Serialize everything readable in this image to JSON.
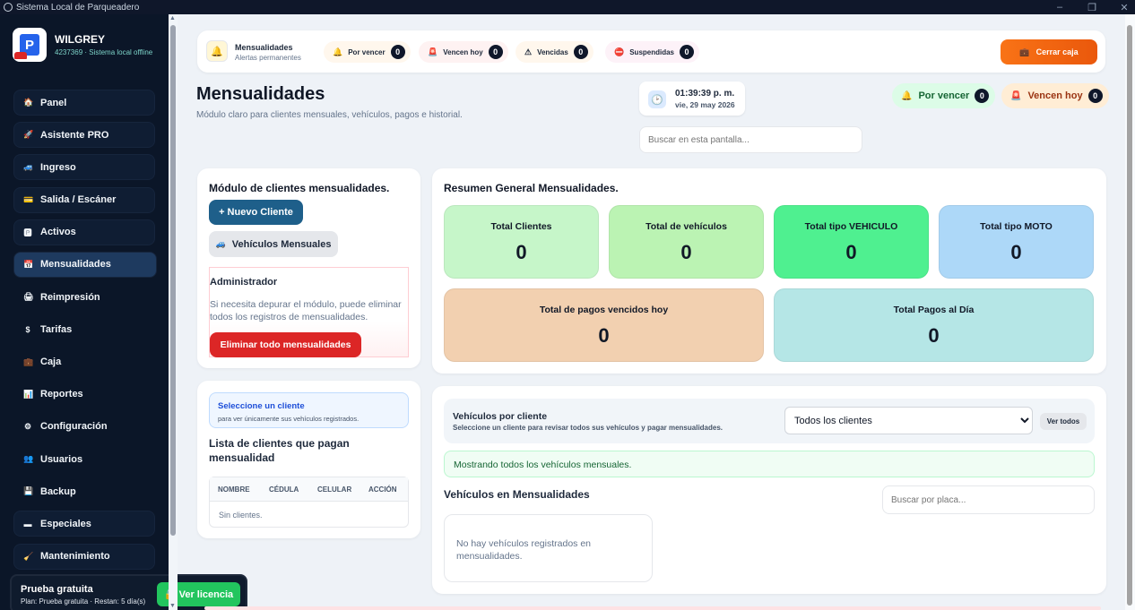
{
  "window": {
    "title": "Sistema Local de Parqueadero",
    "controls": [
      "–",
      "❐",
      "✕"
    ]
  },
  "brand": {
    "name": "WILGREY",
    "subtitle": "4237369 · Sistema local offline"
  },
  "sidebar": {
    "items": [
      {
        "label": "Panel",
        "icon": "home-icon",
        "glyph": "🏠"
      },
      {
        "label": "Asistente PRO",
        "icon": "rocket-icon",
        "glyph": "🚀"
      },
      {
        "label": "Ingreso",
        "icon": "car-icon",
        "glyph": "🚙"
      },
      {
        "label": "Salida / Escáner",
        "icon": "scanner-icon",
        "glyph": "💳"
      },
      {
        "label": "Activos",
        "icon": "parking-icon",
        "glyph": "🅿"
      },
      {
        "label": "Mensualidades",
        "icon": "calendar-icon",
        "glyph": "📅"
      },
      {
        "label": "Reimpresión",
        "icon": "printer-icon",
        "glyph": "🖨"
      },
      {
        "label": "Tarifas",
        "icon": "dollar-icon",
        "glyph": "$"
      },
      {
        "label": "Caja",
        "icon": "briefcase-icon",
        "glyph": "💼"
      },
      {
        "label": "Reportes",
        "icon": "chart-icon",
        "glyph": "📊"
      },
      {
        "label": "Configuración",
        "icon": "gear-icon",
        "glyph": "⚙"
      },
      {
        "label": "Usuarios",
        "icon": "users-icon",
        "glyph": "👥"
      },
      {
        "label": "Backup",
        "icon": "save-icon",
        "glyph": "💾"
      },
      {
        "label": "Especiales",
        "icon": "special-icon",
        "glyph": "▬"
      },
      {
        "label": "Mantenimiento",
        "icon": "broom-icon",
        "glyph": "🧹"
      }
    ],
    "active": "Mensualidades"
  },
  "trial": {
    "title": "Prueba gratuita",
    "plan": "Plan: Prueba gratuita · Restan: 5 día(s)",
    "button": "🔒 Ver licencia"
  },
  "alerts": {
    "title": "Mensualidades",
    "subtitle": "Alertas permanentes",
    "pills": [
      {
        "label": "Por vencer",
        "count": "0",
        "icon": "bell-icon",
        "glyph": "🔔",
        "color": "#fff7ed"
      },
      {
        "label": "Vencen hoy",
        "count": "0",
        "icon": "siren-icon",
        "glyph": "🚨",
        "color": "#fef2f2"
      },
      {
        "label": "Vencidas",
        "count": "0",
        "icon": "warning-icon",
        "glyph": "⚠",
        "color": "#fff7ed"
      },
      {
        "label": "Suspendidas",
        "count": "0",
        "icon": "no-entry-icon",
        "glyph": "⛔",
        "color": "#fdf2f8"
      }
    ],
    "close_button": "Cerrar caja"
  },
  "header": {
    "title": "Mensualidades",
    "subtitle": "Módulo claro para clientes mensuales, vehículos, pagos e historial.",
    "time": "01:39:39 p. m.",
    "date": "vie, 29 may 2026",
    "search_placeholder": "Buscar en esta pantalla...",
    "pills": [
      {
        "label": "Por vencer",
        "count": "0",
        "color": "#dcfce7",
        "text": "#166534",
        "glyph": "🔔"
      },
      {
        "label": "Vencen hoy",
        "count": "0",
        "color": "#ffedd5",
        "text": "#9a3412",
        "glyph": "🚨"
      }
    ]
  },
  "module": {
    "title": "Módulo de clientes mensualidades.",
    "new_client": "+ Nuevo Cliente",
    "vehicles_button": "Vehículos Mensuales",
    "admin_title": "Administrador",
    "admin_desc": "Si necesita depurar el módulo, puede eliminar todos los registros de mensualidades.",
    "delete_button": "Eliminar todo mensualidades"
  },
  "summary": {
    "title": "Resumen General Mensualidades.",
    "stats": [
      {
        "label": "Total Clientes",
        "value": "0",
        "color": "#c6f6c9"
      },
      {
        "label": "Total de vehículos",
        "value": "0",
        "color": "#bbf3b3"
      },
      {
        "label": "Total tipo VEHICULO",
        "value": "0",
        "color": "#4ff090"
      },
      {
        "label": "Total tipo MOTO",
        "value": "0",
        "color": "#add8f8"
      },
      {
        "label": "Total de pagos vencidos hoy",
        "value": "0",
        "color": "#f2d0b0"
      },
      {
        "label": "Total Pagos al Día",
        "value": "0",
        "color": "#b5e6e6"
      }
    ]
  },
  "clients": {
    "select_title": "Seleccione un cliente",
    "select_desc": "para ver únicamente sus vehículos registrados.",
    "list_title": "Lista de clientes que pagan mensualidad",
    "columns": [
      "NOMBRE",
      "CÉDULA",
      "CELULAR",
      "ACCIÓN"
    ],
    "empty": "Sin clientes."
  },
  "vehicles": {
    "by_client_title": "Vehículos por cliente",
    "by_client_desc": "Seleccione un cliente para revisar todos sus vehículos y pagar mensualidades.",
    "select_value": "Todos los clientes",
    "see_all": "Ver todos",
    "info": "Mostrando todos los vehículos mensuales.",
    "list_title": "Vehículos en Mensualidades",
    "plate_placeholder": "Buscar por placa...",
    "empty": "No hay vehículos registrados en mensualidades."
  }
}
